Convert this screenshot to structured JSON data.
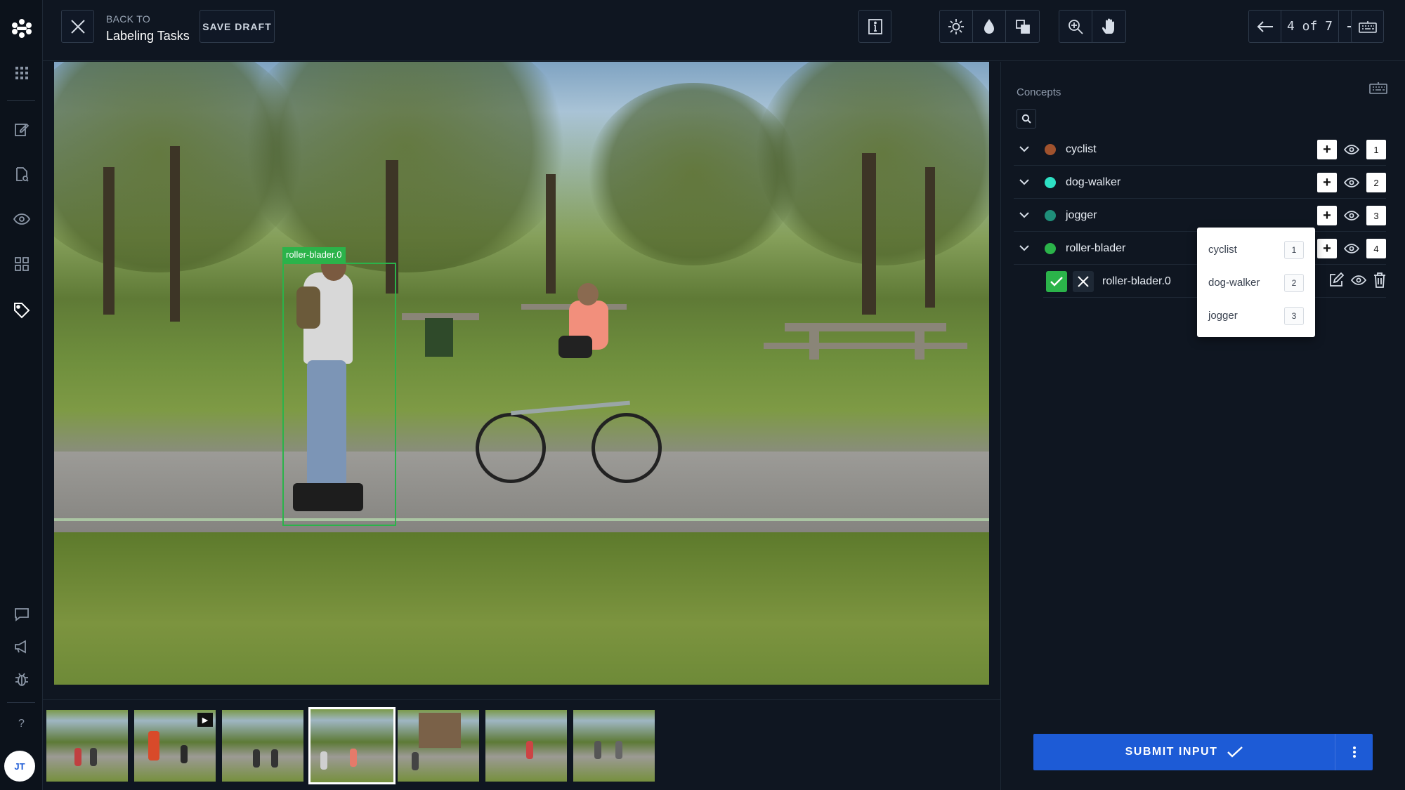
{
  "header": {
    "back_small": "BACK TO",
    "back_big": "Labeling Tasks",
    "save_draft": "SAVE DRAFT",
    "pager_text": "4 of 7"
  },
  "rail": {
    "avatar_initials": "JT",
    "help": "?"
  },
  "canvas": {
    "bbox_label": "roller-blader.0"
  },
  "panel": {
    "title": "Concepts",
    "concepts": [
      {
        "name": "cyclist",
        "color": "#a0522d",
        "shortcut": "1"
      },
      {
        "name": "dog-walker",
        "color": "#2ee0c4",
        "shortcut": "2"
      },
      {
        "name": "jogger",
        "color": "#1f8f7a",
        "shortcut": "3"
      },
      {
        "name": "roller-blader",
        "color": "#2bb34a",
        "shortcut": "4"
      }
    ],
    "annotation": {
      "name": "roller-blader.0"
    },
    "dropdown": [
      {
        "label": "cyclist",
        "key": "1"
      },
      {
        "label": "dog-walker",
        "key": "2"
      },
      {
        "label": "jogger",
        "key": "3"
      }
    ],
    "submit_label": "SUBMIT INPUT"
  },
  "icons": [
    "close-icon",
    "info-icon",
    "brightness-icon",
    "contrast-icon",
    "overlay-icon",
    "zoom-icon",
    "hand-icon",
    "arrow-left-icon",
    "arrow-right-icon",
    "keyboard-icon",
    "search-icon",
    "eye-icon",
    "edit-icon",
    "trash-icon",
    "check-icon",
    "chevron-down-icon",
    "more-vertical-icon",
    "apps-icon",
    "edit-note-icon",
    "file-search-icon",
    "tag-icon",
    "comment-icon",
    "megaphone-icon",
    "bug-icon"
  ]
}
